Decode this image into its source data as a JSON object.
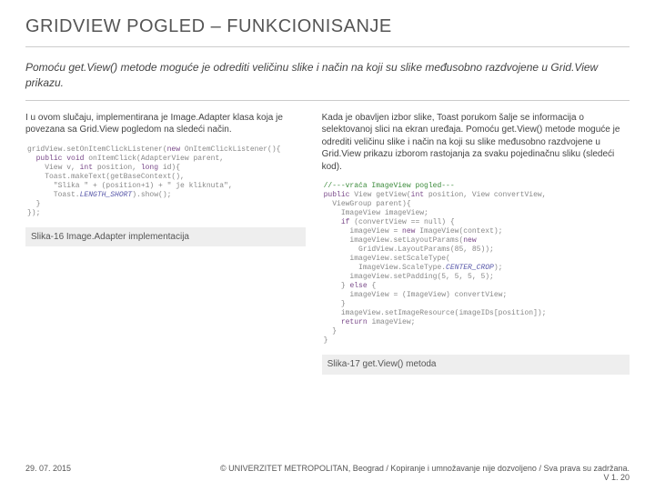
{
  "title": "GRIDVIEW POGLED – FUNKCIONISANJE",
  "intro": "Pomoću get.View() metode moguće je odrediti veličinu slike i način na koji su slike međusobno razdvojene u Grid.View prikazu.",
  "left": {
    "para": "I u ovom slučaju, implementirana je Image.Adapter klasa koja je povezana sa Grid.View pogledom na sledeći način.",
    "caption": "Slika-16 Image.Adapter implementacija",
    "code": [
      "gridView.setOnItemClickListener(new OnItemClickListener(){",
      "  public void onItemClick(AdapterView<?> parent,",
      "    View v, int position, long id){",
      "    Toast.makeText(getBaseContext(),",
      "      \"Slika \" + (position+1) + \" je kliknuta\",",
      "      Toast.LENGTH_SHORT).show();",
      "  }",
      "});"
    ]
  },
  "right": {
    "para": "Kada je obavljen izbor slike, Toast porukom šalje se informacija o selektovanoj slici na ekran uređaja. Pomoću get.View() metode moguće je odrediti veličinu slike i način na koji su slike međusobno razdvojene u Grid.View prikazu izborom rastojanja za svaku pojedinačnu sliku (sledeći kod).",
    "caption": "Slika-17 get.View() metoda",
    "code": [
      "//---vraća ImageView pogled---",
      "public View getView(int position, View convertView,",
      "  ViewGroup parent){",
      "    ImageView imageView;",
      "    if (convertView == null) {",
      "      imageView = new ImageView(context);",
      "      imageView.setLayoutParams(new",
      "        GridView.LayoutParams(85, 85));",
      "      imageView.setScaleType(",
      "        ImageView.ScaleType.CENTER_CROP);",
      "      imageView.setPadding(5, 5, 5, 5);",
      "    } else {",
      "      imageView = (ImageView) convertView;",
      "    }",
      "    imageView.setImageResource(imageIDs[position]);",
      "    return imageView;",
      "  }",
      "}"
    ]
  },
  "footer": {
    "date": "29. 07. 2015",
    "copy_line1": "© UNIVERZITET METROPOLITAN, Beograd / Kopiranje i umnožavanje nije dozvoljeno / Sva prava su zadržana.",
    "copy_line2": "V 1. 20"
  }
}
